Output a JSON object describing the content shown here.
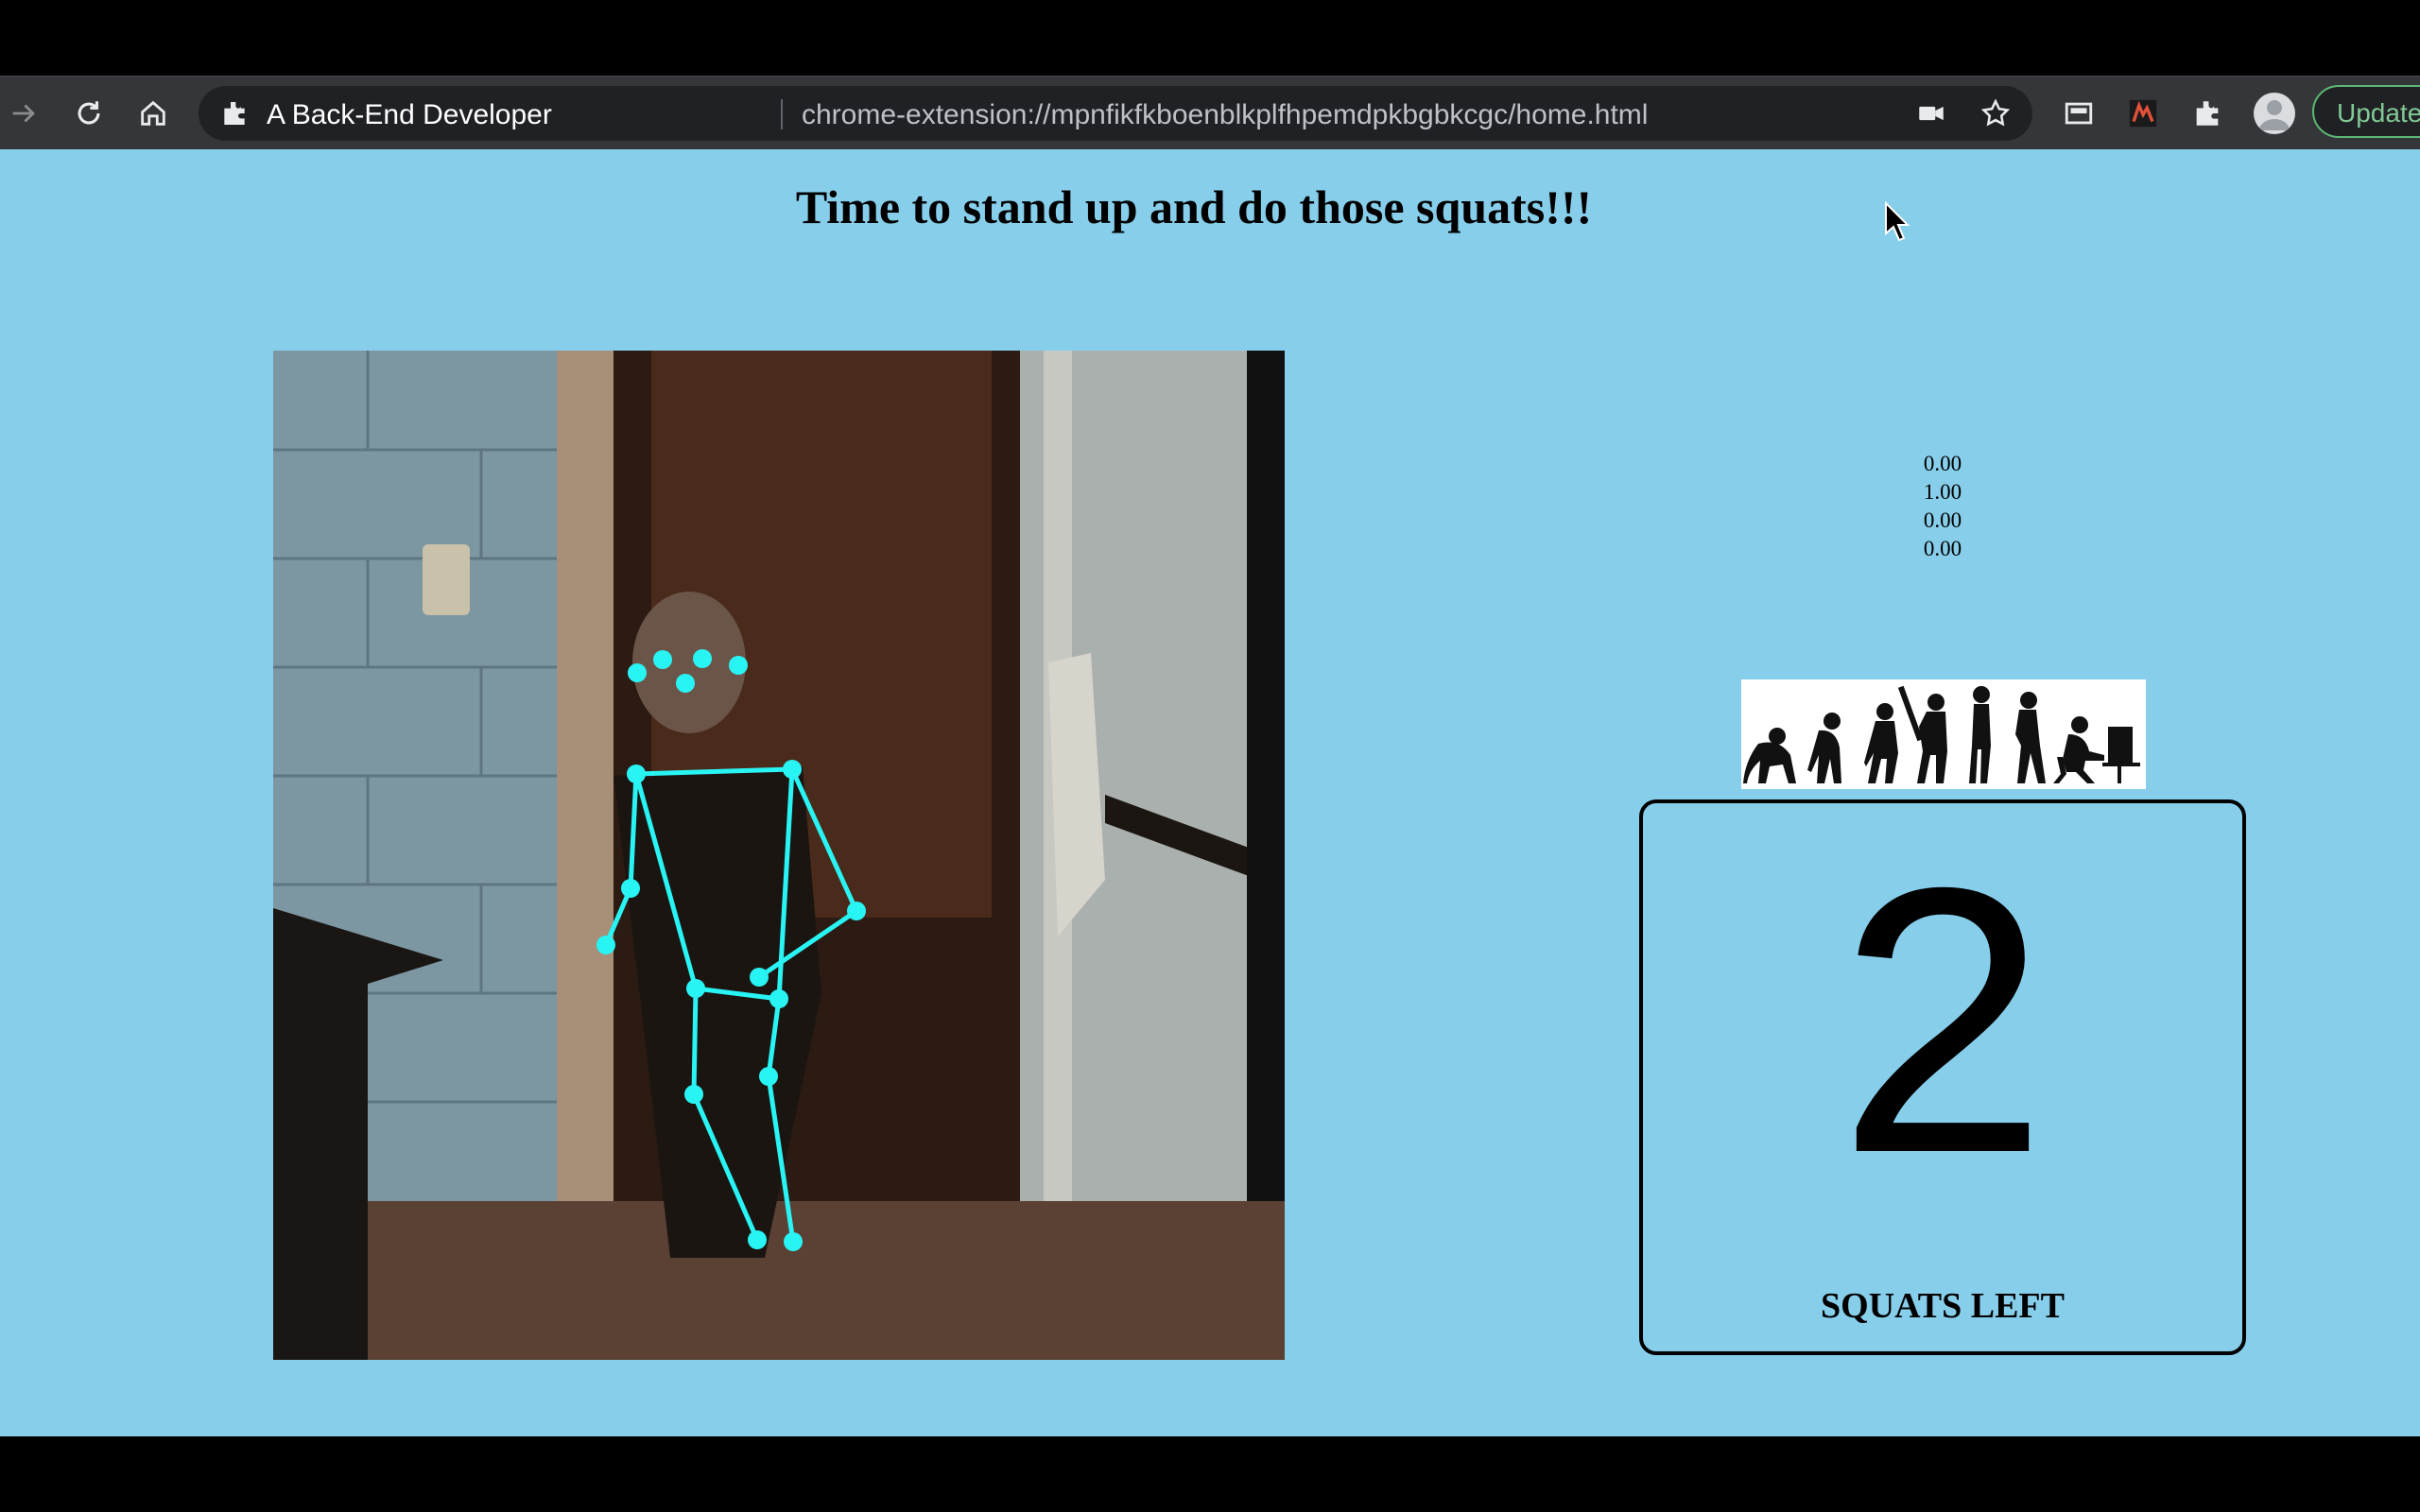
{
  "browser": {
    "tab_title": "A Back-End Developer",
    "url": "chrome-extension://mpnfikfkboenblkplfhpemdpkbgbkcgc/home.html",
    "update_label": "Update",
    "icons": [
      "forward-icon",
      "reload-icon",
      "home-icon",
      "extension-icon",
      "camera-icon",
      "star-icon",
      "picture-in-picture-icon",
      "brand-extension-icon",
      "puzzle-icon",
      "profile-icon"
    ]
  },
  "page": {
    "title": "Time to stand up and do those squats!!!",
    "background": "#87ceeb",
    "readout": [
      "0.00",
      "1.00",
      "0.00",
      "0.00"
    ],
    "counter": {
      "value": "2",
      "label": "SQUATS LEFT"
    },
    "skeleton_color": "#29f4f4"
  }
}
